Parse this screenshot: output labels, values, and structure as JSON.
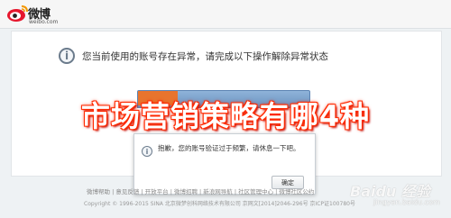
{
  "brand": {
    "name": "微博",
    "domain": "weibo.com"
  },
  "notice": {
    "text": "您当前使用的账号存在异常，请完成以下操作解除异常状态",
    "icon": "info-icon"
  },
  "overlay_title": "市场营销策略有哪4种",
  "dialog": {
    "message": "抱歉，您的账号验证过于频繁，请休息一下吧。",
    "confirm_label": "确定",
    "icon": "info-icon"
  },
  "footer": {
    "links": "微博帮助 | 意见反馈 | 开放平台 | 微博招聘 | 新浪网导航 | 社区管理中心 | 微博社区公约",
    "copyright": "Copyright © 1996-2015 SINA 北京微梦创科网络技术有限公司 京网文[2014]2046-296号 京ICP证100780号"
  },
  "watermark": {
    "text": "Baidu 经验",
    "sub": "jingyan.baidu.com"
  },
  "colors": {
    "overlay_stroke": "#ff2a00",
    "bar_blue": "#6b93c0",
    "tag_orange": "#e8742d"
  }
}
